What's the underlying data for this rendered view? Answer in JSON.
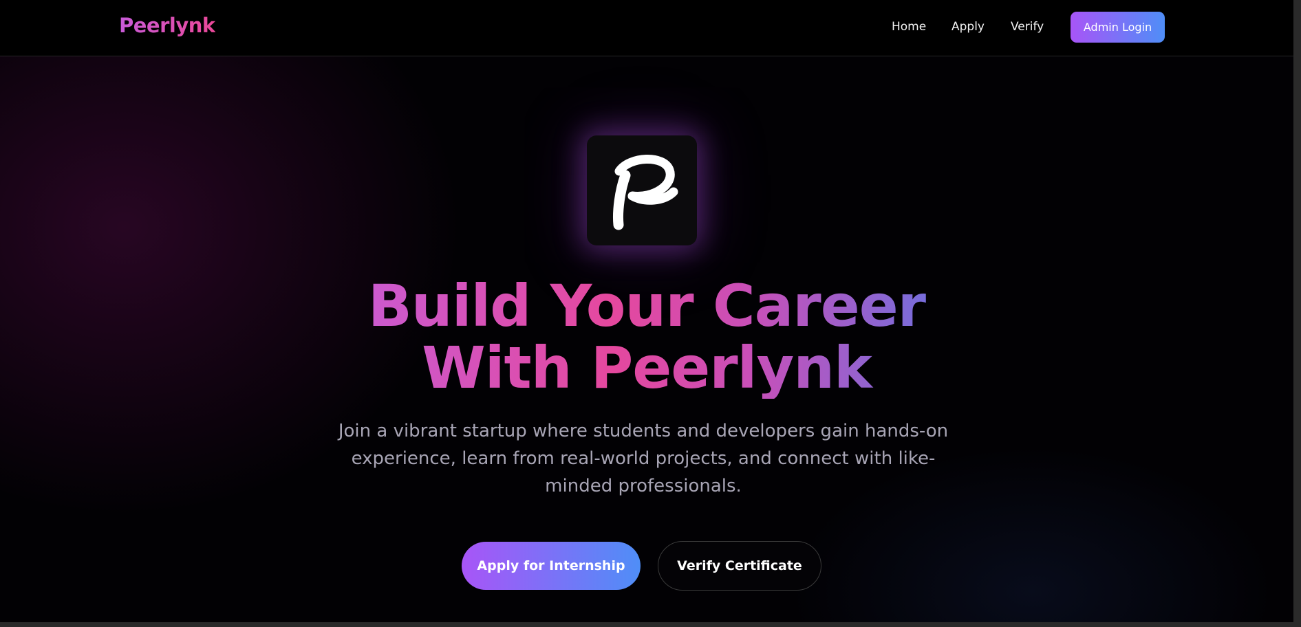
{
  "navbar": {
    "brand": "Peerlynk",
    "links": [
      "Home",
      "Apply",
      "Verify"
    ],
    "admin_button": "Admin Login"
  },
  "logo": {
    "icon": "peerlynk-p-logo-icon"
  },
  "hero": {
    "title_line1": "Build Your Career",
    "title_line2": "With Peerlynk",
    "subtitle": "Join a vibrant startup where students and developers gain hands-on experience, learn from real-world projects, and connect with like-minded professionals.",
    "primary_cta": "Apply for Internship",
    "secondary_cta": "Verify Certificate"
  },
  "colors": {
    "background": "#000000",
    "accent_purple": "#a855f7",
    "accent_blue": "#4f8ef7",
    "accent_pink": "#ec4899",
    "subtitle_text": "#a8a5b5"
  }
}
